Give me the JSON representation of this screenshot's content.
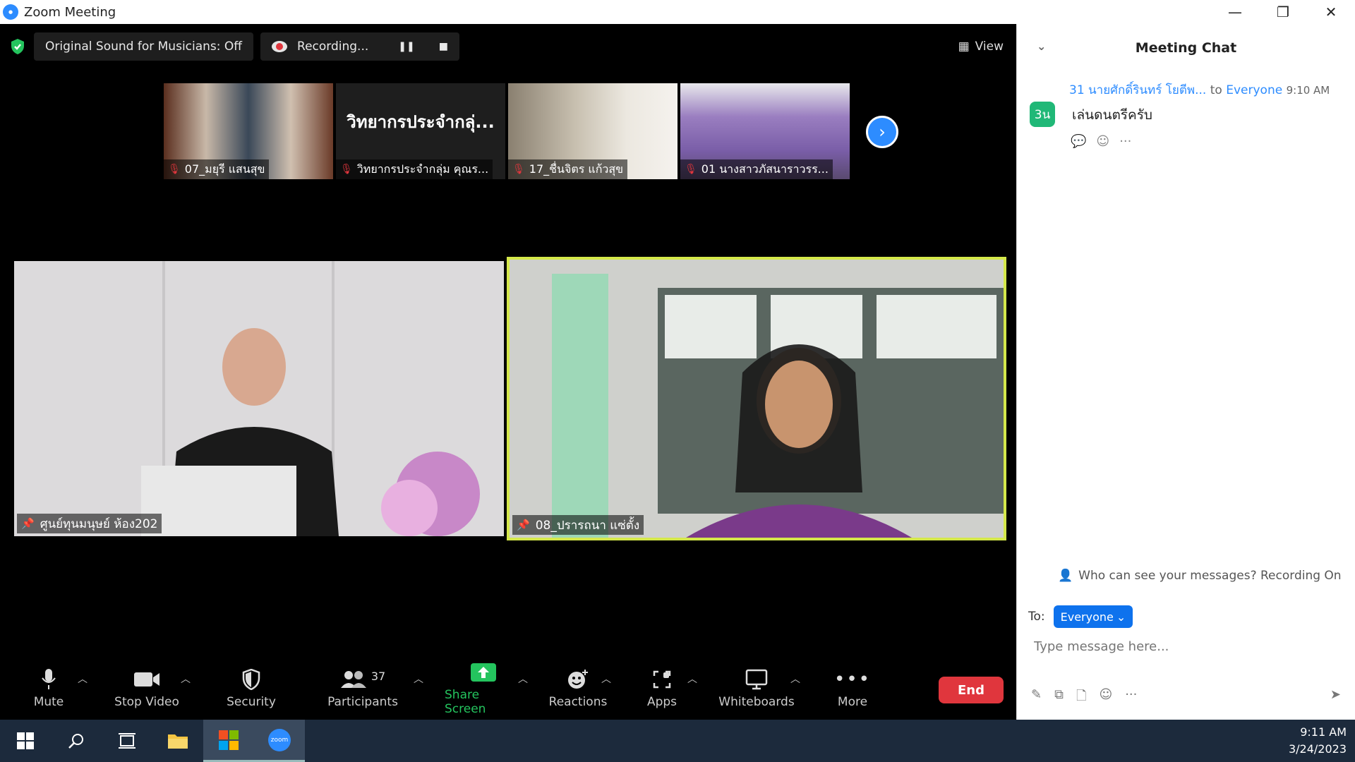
{
  "window": {
    "title": "Zoom Meeting"
  },
  "top_bar": {
    "original_sound": "Original Sound for Musicians: Off",
    "recording": "Recording...",
    "view_label": "View"
  },
  "thumbnails": [
    {
      "name": "07_มยุรี แสนสุข",
      "display_text": ""
    },
    {
      "name": "วิทยากรประจำกลุ่ม คุณร...",
      "display_text": "วิทยากรประจำกลุ่..."
    },
    {
      "name": "17_ชื่นจิตร แก้วสุข",
      "display_text": ""
    },
    {
      "name": "01 นางสาวภัสนาราวรร...",
      "display_text": ""
    }
  ],
  "tiles": {
    "left_name": "ศูนย์ทุนมนุษย์ ห้อง202",
    "right_name": "08_ปรารถนา แซ่ตั้ง"
  },
  "toolbar": {
    "mute": "Mute",
    "stop_video": "Stop Video",
    "security": "Security",
    "participants": "Participants",
    "participants_count": "37",
    "share_screen": "Share Screen",
    "reactions": "Reactions",
    "apps": "Apps",
    "whiteboards": "Whiteboards",
    "more": "More",
    "end": "End"
  },
  "chat": {
    "title": "Meeting Chat",
    "message": {
      "avatar": "3น",
      "sender": "31 นายศักดิ์รินทร์  โยตีพ...",
      "to_label": "to",
      "recipient": "Everyone",
      "time": "9:10 AM",
      "text": "เล่นดนตรีครับ"
    },
    "who_can_see": "Who can see your messages? Recording On",
    "to_label": "To:",
    "to_value": "Everyone",
    "input_placeholder": "Type message here..."
  },
  "taskbar": {
    "time": "9:11 AM",
    "date": "3/24/2023",
    "zoom_label": "zoom"
  },
  "colors": {
    "accent": "#2d8cff",
    "active_speaker": "#d5e84a",
    "end": "#e0363d",
    "share": "#24c45e"
  }
}
